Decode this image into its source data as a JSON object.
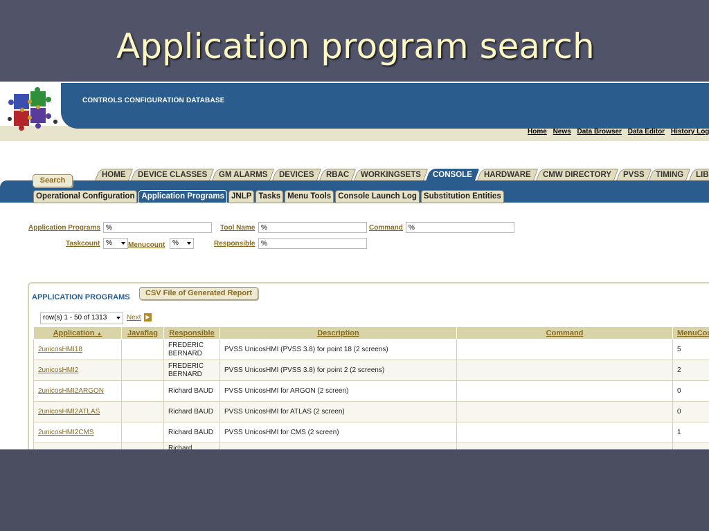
{
  "slide_title": "Application program search",
  "header": {
    "app_name": "CONTROLS  CONFIGURATION  DATABASE",
    "links": [
      "Home",
      "News",
      "Data Browser",
      "Data Editor",
      "History Log"
    ]
  },
  "main_tabs": [
    "HOME",
    "DEVICE CLASSES",
    "GM ALARMS",
    "DEVICES",
    "RBAC",
    "WORKINGSETS",
    "CONSOLE",
    "HARDWARE",
    "CMW DIRECTORY",
    "PVSS",
    "TIMING",
    "LIBR"
  ],
  "main_tab_active": "CONSOLE",
  "sub_tabs": [
    "Operational Configuration",
    "Application Programs",
    "JNLP",
    "Tasks",
    "Menu Tools",
    "Console Launch Log",
    "Substitution Entities"
  ],
  "sub_tab_active": "Application Programs",
  "form": {
    "application_programs_label": "Application Programs",
    "application_programs_value": "%",
    "tool_name_label": "Tool Name",
    "tool_name_value": "%",
    "command_label": "Command",
    "command_value": "%",
    "taskcount_label": "Taskcount",
    "taskcount_value": "%",
    "menucount_label": "Menucount",
    "menucount_value": "%",
    "responsible_label": "Responsible",
    "responsible_value": "%",
    "search_button": "Search"
  },
  "report": {
    "title": "APPLICATION PROGRAMS",
    "csv_button": "CSV File of Generated Report",
    "pager_value": "row(s) 1 - 50 of 1313",
    "next_label": "Next",
    "columns": [
      "Application",
      "Javaflag",
      "Responsible",
      "Description",
      "Command",
      "MenuCou"
    ],
    "sort_indicator": "▲",
    "rows": [
      {
        "application": "2unicosHMI18",
        "javaflag": "",
        "responsible": "FREDERIC BERNARD",
        "description": "PVSS UnicosHMI (PVSS 3.8) for point 18 (2 screens)",
        "command": "",
        "menucount": "5"
      },
      {
        "application": "2unicosHMI2",
        "javaflag": "",
        "responsible": "FREDERIC BERNARD",
        "description": "PVSS UnicosHMI (PVSS 3.8) for point 2 (2 screens)",
        "command": "",
        "menucount": "2"
      },
      {
        "application": "2unicosHMI2ARGON",
        "javaflag": "",
        "responsible": "Richard BAUD",
        "description": "PVSS UnicosHMI for ARGON (2 screen)",
        "command": "",
        "menucount": "0"
      },
      {
        "application": "2unicosHMI2ATLAS",
        "javaflag": "",
        "responsible": "Richard BAUD",
        "description": "PVSS UnicosHMI for ATLAS (2 screen)",
        "command": "",
        "menucount": "0"
      },
      {
        "application": "2unicosHMI2CMS",
        "javaflag": "",
        "responsible": "Richard BAUD",
        "description": "PVSS UnicosHMI for CMS (2 screen)",
        "command": "",
        "menucount": "1"
      },
      {
        "application": "",
        "javaflag": "",
        "responsible": "Richard",
        "description": "",
        "command": "",
        "menucount": ""
      }
    ]
  }
}
